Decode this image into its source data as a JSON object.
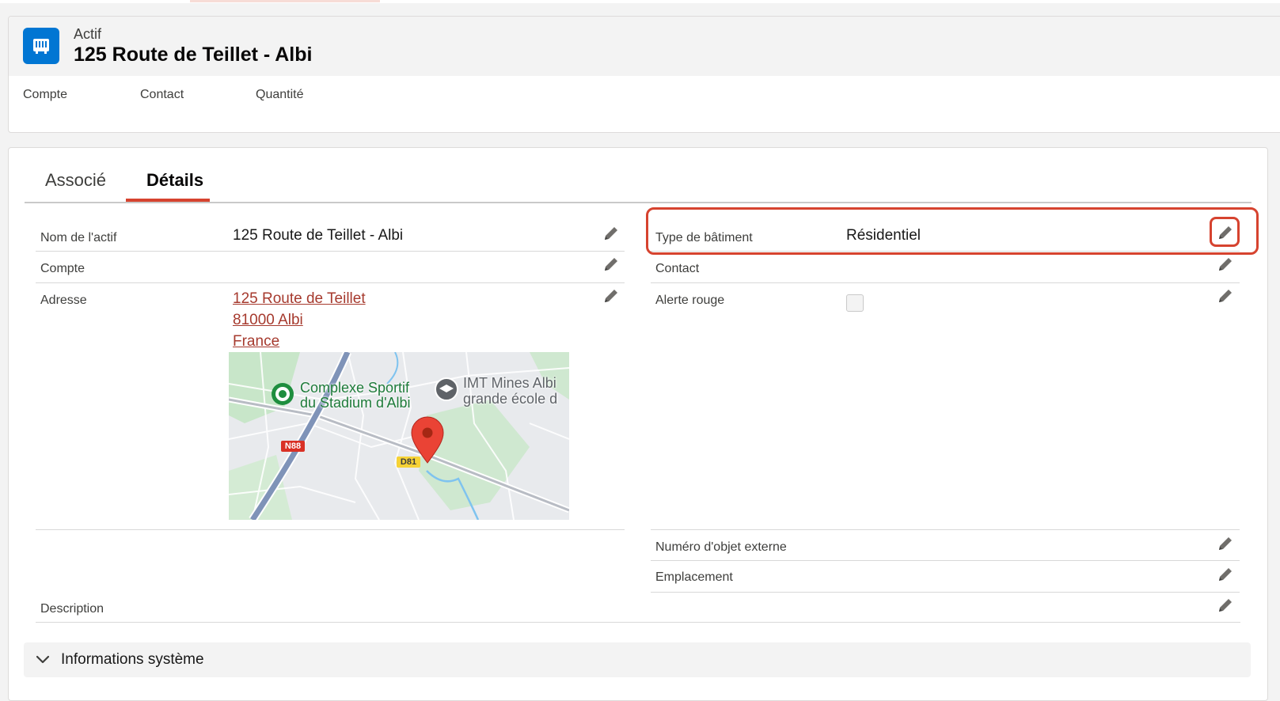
{
  "header": {
    "object_label": "Actif",
    "record_title": "125 Route de Teillet - Albi",
    "highlights": [
      "Compte",
      "Contact",
      "Quantité"
    ]
  },
  "tabs": [
    {
      "label": "Associé",
      "active": false
    },
    {
      "label": "Détails",
      "active": true
    }
  ],
  "fields_left": {
    "nom": {
      "label": "Nom de l'actif",
      "value": "125 Route de Teillet - Albi"
    },
    "compte": {
      "label": "Compte",
      "value": ""
    },
    "adresse": {
      "label": "Adresse",
      "lines": [
        "125 Route de Teillet",
        "81000 Albi",
        "France"
      ]
    },
    "description": {
      "label": "Description",
      "value": ""
    }
  },
  "fields_right": {
    "type_batiment": {
      "label": "Type de bâtiment",
      "value": "Résidentiel"
    },
    "contact": {
      "label": "Contact",
      "value": ""
    },
    "alerte_rouge": {
      "label": "Alerte rouge",
      "checked": false
    },
    "numero_objet": {
      "label": "Numéro d'objet externe",
      "value": ""
    },
    "emplacement": {
      "label": "Emplacement",
      "value": ""
    }
  },
  "map": {
    "poi_1": [
      "Complexe Sportif",
      "du Stadium d'Albi"
    ],
    "poi_2": [
      "IMT Mines Albi",
      "grande école d"
    ],
    "road_1": "N88",
    "road_2": "D81"
  },
  "section": {
    "title": "Informations système",
    "expanded": false
  },
  "colors": {
    "accent": "#d6432f",
    "link": "#a63a2e",
    "icon_bg": "#0176d3"
  }
}
